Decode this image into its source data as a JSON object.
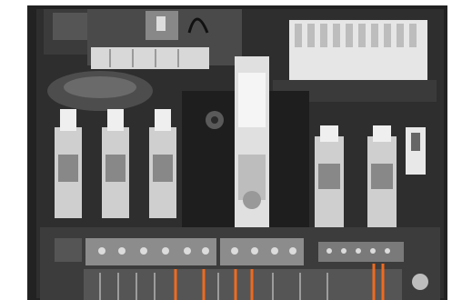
{
  "photo": {
    "subject": "circuit-board",
    "palette": {
      "background": "#ffffff",
      "board": "#2e2e2e",
      "board_dark": "#1a1a1a",
      "component": "#d6d6d6",
      "component_light": "#efefef",
      "connector": "#9a9a9a",
      "wire_highlight": "#f06a1e"
    },
    "highlighted_wire_count": 6
  }
}
